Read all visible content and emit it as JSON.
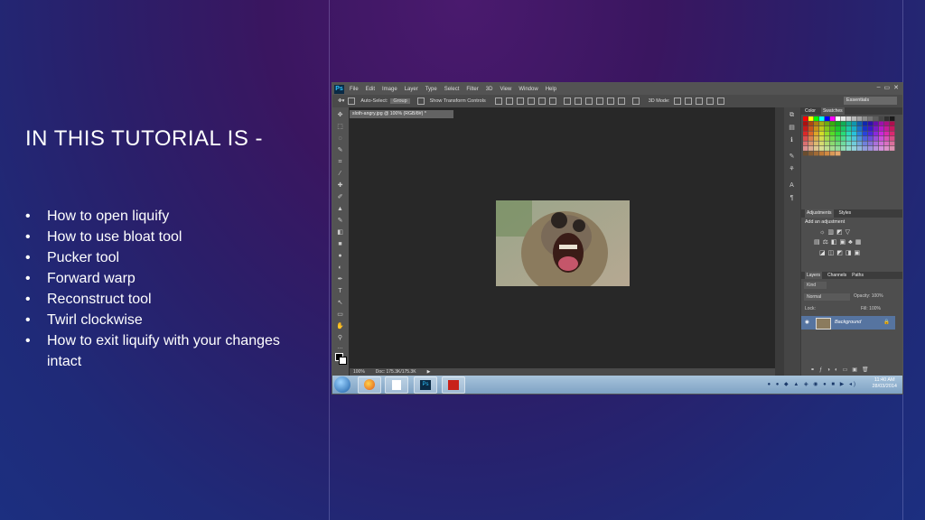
{
  "slide": {
    "title": "IN THIS TUTORIAL IS -",
    "bullets": [
      "How to open liquify",
      "How to use bloat tool",
      "Pucker tool",
      "Forward warp",
      "Reconstruct tool",
      "Twirl clockwise",
      "How to exit liquify with your changes intact"
    ]
  },
  "photoshop": {
    "logo": "Ps",
    "menu": [
      "File",
      "Edit",
      "Image",
      "Layer",
      "Type",
      "Select",
      "Filter",
      "3D",
      "View",
      "Window",
      "Help"
    ],
    "window_controls": [
      "–",
      "▭",
      "✕"
    ],
    "options": {
      "auto_select": "Auto-Select:",
      "group_value": "Group",
      "transform": "Show Transform Controls",
      "mode_3d": "3D Mode:",
      "workspace": "Essentials"
    },
    "document_tab": "sloth-angry.jpg @ 100% (RGB/8#) *",
    "status": {
      "zoom": "100%",
      "doc": "Doc: 175.3K/175.3K"
    },
    "panels": {
      "color_tabs": [
        "Color",
        "Swatches"
      ],
      "adjust_tabs": [
        "Adjustments",
        "Styles"
      ],
      "add_adjustment": "Add an adjustment",
      "layers_tabs": [
        "Layers",
        "Channels",
        "Paths"
      ],
      "kind": "Kind",
      "blend": "Normal",
      "opacity": "Opacity: 100%",
      "lock": "Lock:",
      "fill": "Fill: 100%",
      "layer_name": "Background"
    },
    "taskbar": {
      "time": "11:40 AM",
      "date": "28/03/2014"
    }
  }
}
